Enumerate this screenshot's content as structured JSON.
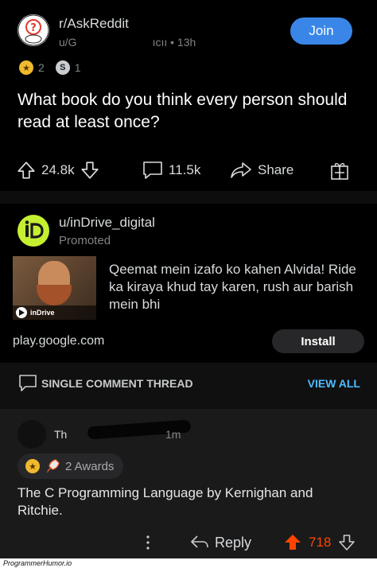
{
  "post": {
    "subreddit": "r/AskReddit",
    "author_prefix": "u/G",
    "author_suffix": "ıcıı",
    "time": "• 13h",
    "join_label": "Join",
    "awards": [
      {
        "icon": "gold-award-icon",
        "count": "2"
      },
      {
        "icon": "silver-award-icon",
        "count": "1"
      }
    ],
    "title": "What book do you think every person should read at least once?",
    "upvotes": "24.8k",
    "comments": "11.5k",
    "share_label": "Share",
    "colors": {
      "join": "#3a86e8",
      "background": "#000000"
    }
  },
  "ad": {
    "user": "u/inDrive_digital",
    "promoted": "Promoted",
    "text": "Qeemat mein izafo ko kahen Alvida! Ride ka kiraya khud tay karen, rush aur barish mein bhi",
    "thumb_brand": "inDrive",
    "domain": "play.google.com",
    "install_label": "Install",
    "colors": {
      "logo": "#c5f032"
    }
  },
  "thread": {
    "label": "SINGLE COMMENT THREAD",
    "view_all": "VIEW ALL",
    "colors": {
      "view_all": "#4fbcff"
    }
  },
  "comment": {
    "user_visible": "Th",
    "time": "1m",
    "awards_label": "2 Awards",
    "body": "The C Programming Language by Kernighan and Ritchie.",
    "reply_label": "Reply",
    "score": "718",
    "colors": {
      "score": "#ff4500"
    }
  },
  "footer": {
    "watermark": "ProgrammerHumor.io"
  }
}
